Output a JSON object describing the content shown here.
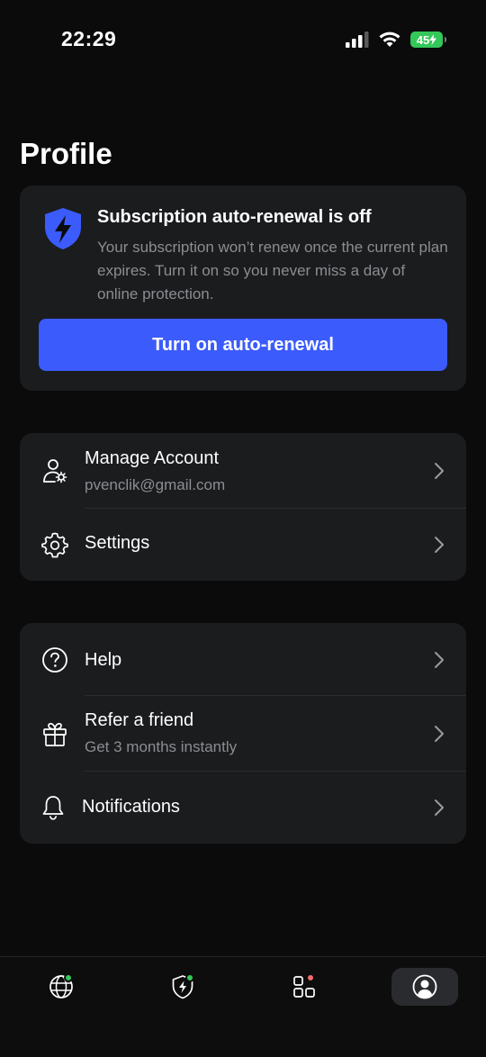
{
  "status_bar": {
    "time": "22:29",
    "battery": "45"
  },
  "page": {
    "title": "Profile"
  },
  "subscription": {
    "title": "Subscription auto-renewal is off",
    "text": "Your subscription won’t renew once the current plan expires. Turn it on so you never miss a day of online protection.",
    "button_label": "Turn on auto-renewal"
  },
  "account_section": {
    "manage_account": {
      "label": "Manage Account",
      "email": "pvenclik@gmail.com"
    },
    "settings": {
      "label": "Settings"
    }
  },
  "help_section": {
    "help": {
      "label": "Help"
    },
    "refer": {
      "label": "Refer a friend",
      "sub": "Get 3 months instantly"
    },
    "notifications": {
      "label": "Notifications"
    }
  },
  "tab_bar": {
    "tabs": [
      {
        "name": "globe-tab",
        "badge": "#34c759"
      },
      {
        "name": "shield-tab",
        "badge": "#34c759"
      },
      {
        "name": "apps-tab",
        "badge": "#f26b6b"
      },
      {
        "name": "profile-tab",
        "active": true
      }
    ]
  },
  "colors": {
    "accent": "#3b5bfc",
    "background": "#0b0b0c",
    "card": "#1b1c1e",
    "muted_text": "#8c8d92"
  }
}
